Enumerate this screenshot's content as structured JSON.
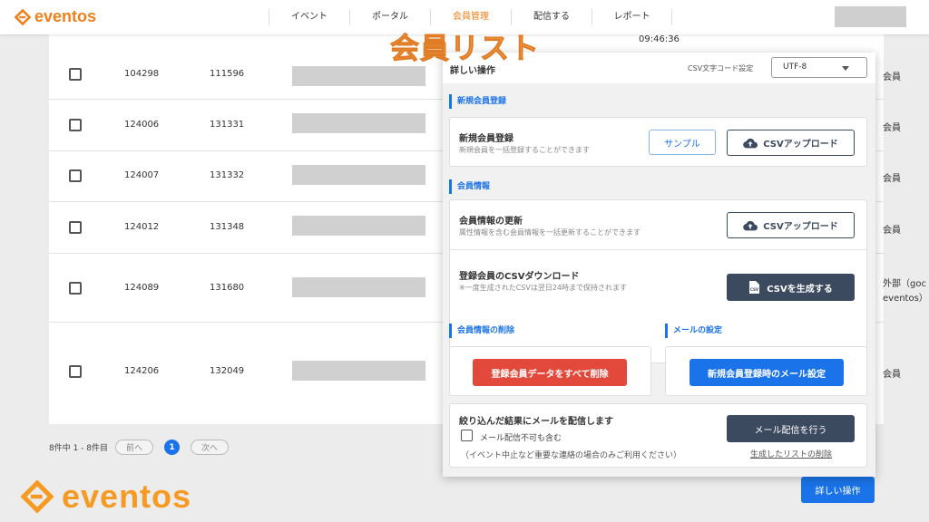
{
  "header": {
    "brand": "eventos",
    "nav": [
      {
        "label": "イベント",
        "active": false
      },
      {
        "label": "ポータル",
        "active": false
      },
      {
        "label": "会員管理",
        "active": true
      },
      {
        "label": "配信する",
        "active": false
      },
      {
        "label": "レポート",
        "active": false
      }
    ]
  },
  "overlay_title": "会員リスト",
  "table": {
    "time": "09:46:36",
    "rows": [
      {
        "id1": "104298",
        "id2": "111596",
        "last": "会員"
      },
      {
        "id1": "124006",
        "id2": "131331",
        "last": "会員"
      },
      {
        "id1": "124007",
        "id2": "131332",
        "last": "会員"
      },
      {
        "id1": "124012",
        "id2": "131348",
        "last": "会員"
      },
      {
        "id1": "124089",
        "id2": "131680",
        "last": "外部（goc",
        "last2": "eventos）"
      },
      {
        "id1": "124206",
        "id2": "132049",
        "last": "会員"
      }
    ]
  },
  "pager": {
    "summary": "8件中 1 - 8件目",
    "prev": "前へ",
    "current": "1",
    "next": "次へ"
  },
  "panel": {
    "title": "詳しい操作",
    "csv_label": "CSV文字コード設定",
    "csv_value": "UTF-8",
    "sec_register": "新規会員登録",
    "register_title": "新規会員登録",
    "register_desc": "新規会員を一括登録することができます",
    "sample_btn": "サンプル",
    "csv_upload": "CSVアップロード",
    "sec_info": "会員情報",
    "update_title": "会員情報の更新",
    "update_desc": "属性情報を含む会員情報を一括更新することができます",
    "download_title": "登録会員のCSVダウンロード",
    "download_desc": "※一度生成されたCSVは翌日24時まで保持されます",
    "generate_btn": "CSVを生成する",
    "sec_delete": "会員情報の削除",
    "delete_btn": "登録会員データをすべて削除",
    "sec_mail": "メールの設定",
    "mail_setting_btn": "新規会員登録時のメール設定",
    "send_title": "絞り込んだ結果にメールを配信します",
    "send_checkbox": "メール配信不可も含む",
    "send_note": "（イベント中止など重要な連絡の場合のみご利用ください）",
    "send_btn": "メール配信を行う",
    "delete_list_link": "生成したリストの削除"
  },
  "detail_button": "詳しい操作",
  "footer_logo": "eventos",
  "colors": {
    "brand": "#ef7f1a",
    "accent": "#1a73e8",
    "dark": "#3c4a60",
    "danger": "#e2493a"
  }
}
